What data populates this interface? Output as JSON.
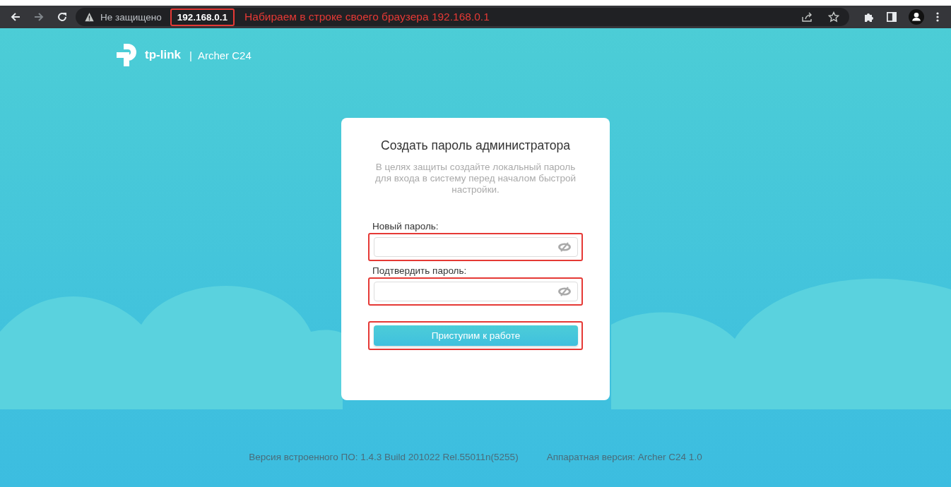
{
  "browser": {
    "security_label": "Не защищено",
    "url": "192.168.0.1",
    "url_highlighted": true,
    "annotation": "Набираем в строке своего браузера 192.168.0.1"
  },
  "header": {
    "brand": "tp-link",
    "separator": "|",
    "model": "Archer C24"
  },
  "card": {
    "title": "Создать пароль администратора",
    "description": "В целях защиты создайте локальный пароль для входа в систему перед началом быстрой настройки.",
    "fields": [
      {
        "label": "Новый пароль:",
        "highlighted": true
      },
      {
        "label": "Подтвердить пароль:",
        "highlighted": true
      }
    ],
    "button": {
      "label": "Приступим к работе",
      "highlighted": true
    }
  },
  "footer": {
    "firmware": "Версия встроенного ПО: 1.4.3 Build 201022 Rel.55011n(5255)",
    "hardware": "Аппаратная версия: Archer C24 1.0"
  }
}
